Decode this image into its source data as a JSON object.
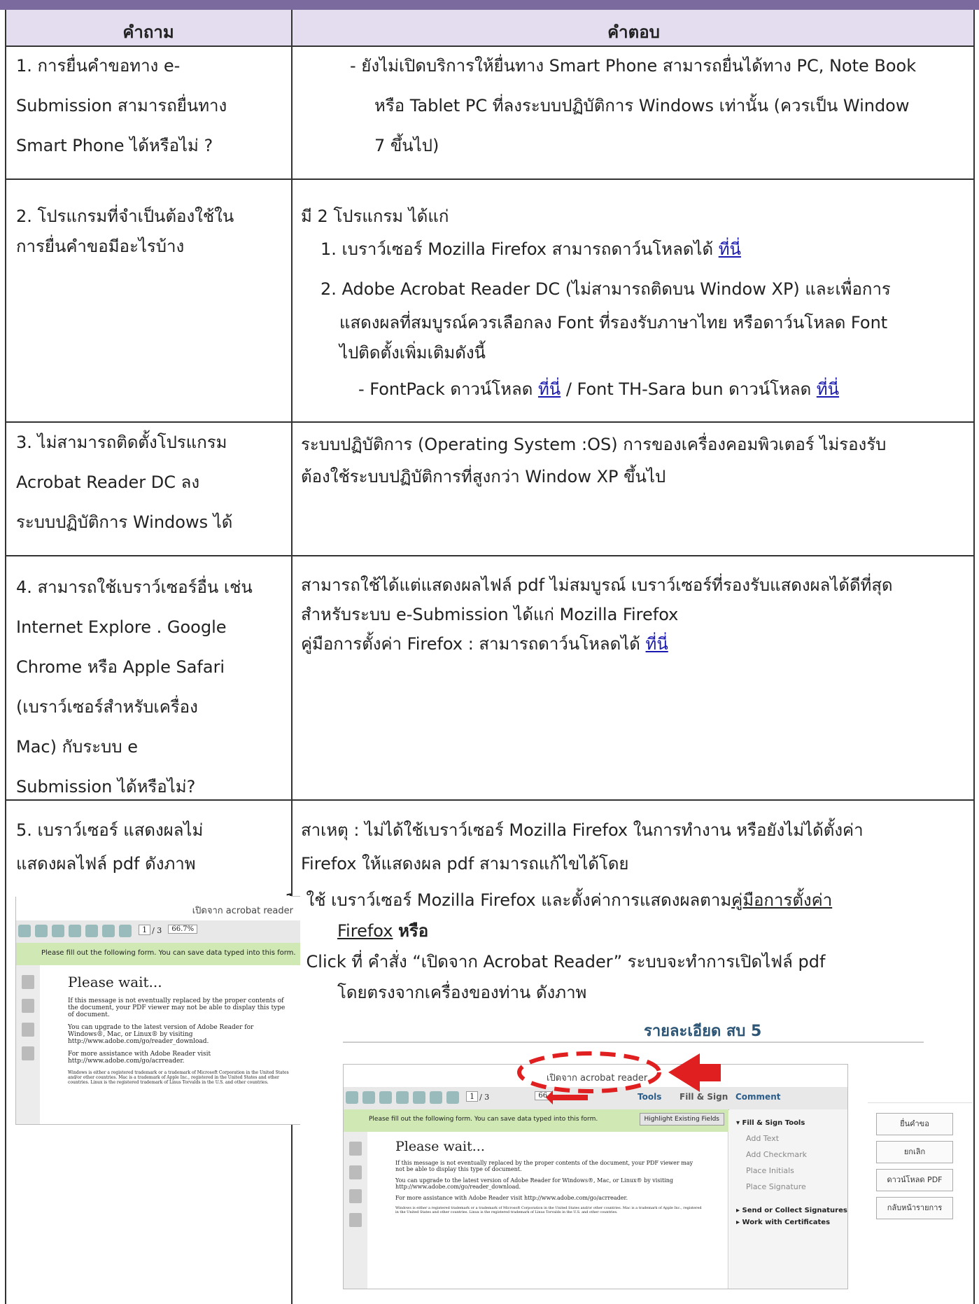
{
  "header": {
    "question": "คำถาม",
    "answer": "คำตอบ"
  },
  "rows": [
    {
      "q": [
        "1.  การยื่นคำขอทาง e-",
        "     Submission สามารถยื่นทาง",
        "     Smart Phone ได้หรือไม่ ?"
      ],
      "a": [
        "-   ยังไม่เปิดบริการให้ยื่นทาง Smart Phone สามารถยื่นได้ทาง PC, Note Book",
        "หรือ Tablet PC ที่ลงระบบปฏิบัติการ Windows เท่านั้น (ควรเป็น Window",
        "7 ขึ้นไป)"
      ]
    },
    {
      "q": [
        "2.  โปรแกรมที่จำเป็นต้องใช้ใน",
        "     การยื่นคำขอมีอะไรบ้าง"
      ],
      "intro": "มี 2 โปรแกรม ได้แก่",
      "item1_text": "1.  เบราว์เซอร์ Mozilla Firefox สามารถดาว์นโหลดได้ ",
      "item1_link": "ที่นี่",
      "item2": [
        "2.  Adobe Acrobat Reader DC (ไม่สามารถติดบน Window XP) และเพื่อการ",
        "แสดงผลที่สมบูรณ์ควรเลือกลง Font ที่รองรับภาษาไทย หรือดาว์นโหลด Font",
        "ไปติดตั้งเพิ่มเติมดังนี้"
      ],
      "font_pre": "-      FontPack ดาวน์โหลด ",
      "font_link1": "ที่นี่",
      "font_mid": " / Font TH-Sara bun ดาวน์โหลด ",
      "font_link2": "ที่นี่"
    },
    {
      "q": [
        "3.  ไม่สามารถติดตั้งโปรแกรม",
        "     Acrobat Reader DC ลง",
        "     ระบบปฏิบัติการ Windows ได้"
      ],
      "a": [
        "ระบบปฏิบัติการ (Operating System :OS) การของเครื่องคอมพิวเตอร์ ไม่รองรับ",
        "ต้องใช้ระบบปฏิบัติการที่สูงกว่า Window XP ขึ้นไป"
      ]
    },
    {
      "q": [
        "4.  สามารถใช้เบราว์เซอร์อื่น เช่น",
        "     Internet Explore . Google",
        "     Chrome หรือ Apple Safari",
        "     (เบราว์เซอร์สำหรับเครื่อง",
        "     Mac) กับระบบ e",
        "     Submission ได้หรือไม่?"
      ],
      "a": [
        "สามารถใช้ได้แต่แสดงผลไฟล์ pdf ไม่สมบูรณ์ เบราว์เซอร์ที่รองรับแสดงผลได้ดีที่สุด",
        "สำหรับระบบ e-Submission ได้แก่ Mozilla Firefox"
      ],
      "manual_text": "คู่มือการตั้งค่า Firefox : สามารถดาว์นโหลดได้ ",
      "manual_link": "ที่นี่"
    },
    {
      "q": [
        "5.  เบราว์เซอร์ แสดงผลไม่",
        "     แสดงผลไฟล์ pdf ดังภาพ"
      ],
      "a": [
        "สาเหตุ : ไม่ได้ใช้เบราว์เซอร์ Mozilla Firefox ในการทำงาน หรือยังไม่ได้ตั้งค่า",
        "Firefox ให้แสดงผล pdf สามารถแก้ไขได้โดย"
      ],
      "step1_pre": "1.   ใช้ เบราว์เซอร์ Mozilla Firefox และตั้งค่าการแสดงผลตาม",
      "step1_link": "คู่มือการตั้งค่า",
      "step1_link2": "Firefox",
      "step1_bold": "หรือ",
      "step2": [
        "2.   Click ที่ คำสั่ง “เปิดจาก Acrobat Reader” ระบบจะทำการเปิดไฟล์ pdf",
        "โดยตรงจากเครื่องของท่าน ดังภาพ"
      ]
    }
  ],
  "shot_small": {
    "open_label": "เปิดจาก acrobat reader",
    "page_num": "1",
    "page_total": "/ 3",
    "zoom": "66.7%",
    "green_text": "Please fill out the following form. You can save data typed into this form.",
    "wait": "Please wait...",
    "p1": "If this message is not eventually replaced by the proper contents of the document, your PDF viewer may not be able to display this type of document.",
    "p2": "You can upgrade to the latest version of Adobe Reader for Windows®, Mac, or Linux® by visiting  http://www.adobe.com/go/reader_download.",
    "p3": "For more assistance with Adobe Reader visit  http://www.adobe.com/go/acrreader.",
    "p4": "Windows is either a registered trademark or a trademark of Microsoft Corporation in the United States and/or other countries. Mac is a trademark of Apple Inc., registered in the United States and other countries. Linux is the registered trademark of Linus Torvalds in the U.S. and other countries."
  },
  "shot_big": {
    "title": "รายละเอียด สบ 5",
    "open_label": "เปิดจาก acrobat reader",
    "page_num": "1",
    "page_total": "/ 3",
    "zoom": "66.",
    "tools": "Tools",
    "fill_sign": "Fill & Sign",
    "comment": "Comment",
    "highlight": "Highlight Existing Fields",
    "green_text": "Please fill out the following form. You can save data typed into this form.",
    "panel_title": "Fill & Sign Tools",
    "panel_items": [
      "Add Text",
      "Add Checkmark",
      "Place Initials",
      "Place Signature"
    ],
    "send": "Send or Collect Signatures",
    "certs": "Work with Certificates",
    "wait": "Please wait...",
    "p1": "If this message is not eventually replaced by the proper contents of the document, your PDF viewer may not be able to display this type of document.",
    "p2": "You can upgrade to the latest version of Adobe Reader for Windows®, Mac, or Linux® by visiting  http://www.adobe.com/go/reader_download.",
    "p3": "For more assistance with Adobe Reader visit  http://www.adobe.com/go/acrreader.",
    "p4": "Windows is either a registered trademark or a trademark of Microsoft Corporation in the United States and/or other countries. Mac is a trademark of Apple Inc., registered in the United States and other countries. Linux is the registered trademark of Linus Torvalds in the U.S. and other countries."
  },
  "buttons": [
    "ยื่นคำขอ",
    "ยกเลิก",
    "ดาวน์โหลด PDF",
    "กลับหน้ารายการ"
  ],
  "colors": {
    "topbar": "#7b6a9e",
    "header_bg": "#e3ddef",
    "link": "#1a1ab0",
    "annotation": "#e02020"
  }
}
